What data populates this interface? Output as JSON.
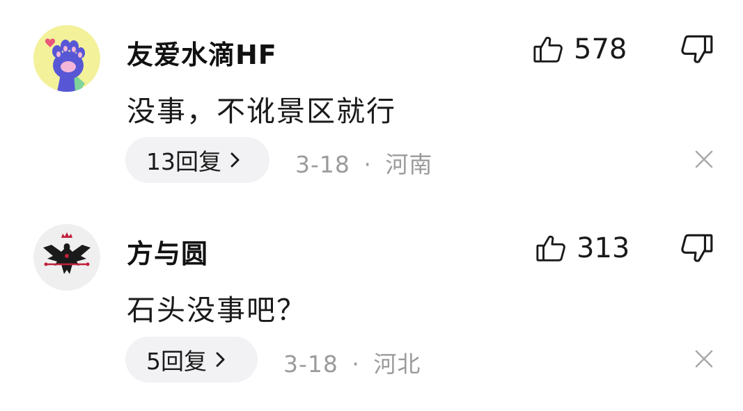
{
  "comments": [
    {
      "username": "友爱水滴HF",
      "content": "没事，不讹景区就行",
      "like_count": "578",
      "reply_label": "13回复",
      "date": "3-18",
      "separator": "·",
      "location": "河南",
      "avatar_icon": "paw-avatar-icon"
    },
    {
      "username": "方与圆",
      "content": "石头没事吧？",
      "like_count": "313",
      "reply_label": "5回复",
      "date": "3-18",
      "separator": "·",
      "location": "河北",
      "avatar_icon": "eagle-crest-avatar-icon"
    }
  ],
  "colors": {
    "text": "#1a1a1a",
    "meta": "#9b9b9b",
    "pill_bg": "#f2f2f4",
    "avatar1_bg": "#f3f19a",
    "paw": "#5757d6"
  }
}
